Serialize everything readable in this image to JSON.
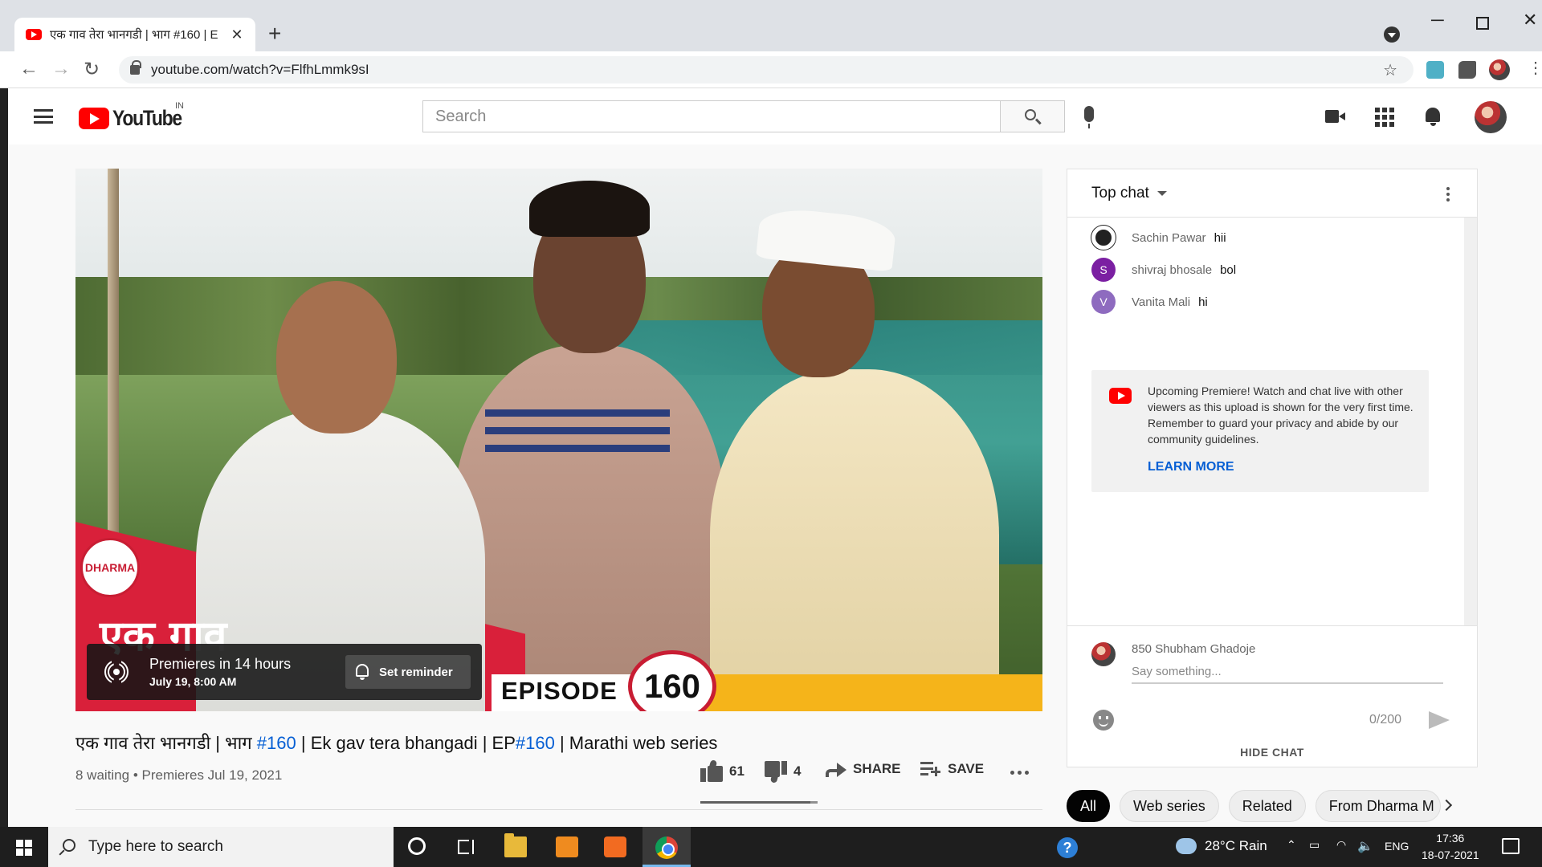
{
  "browser": {
    "tab_title": "एक गाव तेरा भानगडी | भाग #160 | E",
    "url": "youtube.com/watch?v=FlfhLmmk9sI"
  },
  "youtube": {
    "logo_text": "YouTube",
    "country_code": "IN",
    "search_placeholder": "Search"
  },
  "player": {
    "thumbnail_title": "एक गाव",
    "brand_logo_text": "DHARMA",
    "episode_label": "EPISODE",
    "episode_number": "160",
    "premiere_line1": "Premieres in 14 hours",
    "premiere_line2": "July 19, 8:00 AM",
    "reminder_label": "Set reminder"
  },
  "video": {
    "title_part1": "एक गाव तेरा भानगडी | भाग ",
    "title_tag1": "#160",
    "title_part2": " | Ek gav tera bhangadi | EP",
    "title_tag2": "#160",
    "title_part3": " | Marathi web series",
    "meta": "8 waiting • Premieres Jul 19, 2021",
    "likes": "61",
    "dislikes": "4",
    "like_ratio": 0.94,
    "share_label": "SHARE",
    "save_label": "SAVE"
  },
  "chat": {
    "header": "Top chat",
    "messages": [
      {
        "author": "Sachin Pawar",
        "text": "hii",
        "initial": ""
      },
      {
        "author": "shivraj bhosale",
        "text": "bol",
        "initial": "S"
      },
      {
        "author": "Vanita Mali",
        "text": "hi",
        "initial": "V"
      }
    ],
    "notice_text": "Upcoming Premiere! Watch and chat live with other viewers as this upload is shown for the very first time. Remember to guard your privacy and abide by our community guidelines.",
    "learn_more": "LEARN MORE",
    "user_name": "850 Shubham Ghadoje",
    "input_placeholder": "Say something...",
    "char_counter": "0/200",
    "hide_chat": "HIDE CHAT"
  },
  "chips": [
    "All",
    "Web series",
    "Related",
    "From Dharma M"
  ],
  "taskbar": {
    "search_placeholder": "Type here to search",
    "weather": "28°C  Rain",
    "language": "ENG",
    "time": "17:36",
    "date": "18-07-2021"
  },
  "colors": {
    "youtube_red": "#ff0000",
    "link_blue": "#065fd4",
    "episode_yellow": "#f5b41a",
    "thumbnail_red": "#c81d33"
  }
}
